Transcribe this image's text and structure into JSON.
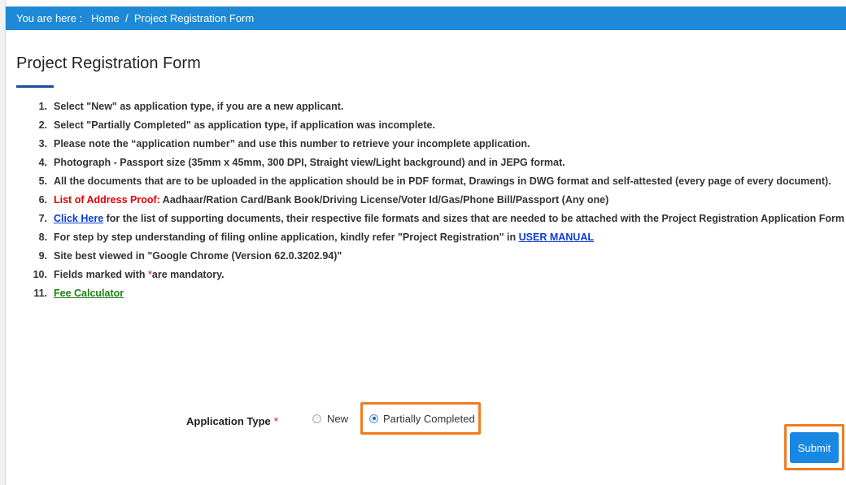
{
  "breadcrumb": {
    "prefix": "You are here :",
    "home": "Home",
    "separator": "/",
    "current": "Project Registration Form"
  },
  "page": {
    "title": "Project Registration Form"
  },
  "instructions": [
    {
      "num": "1.",
      "text": "Select \"New\" as application type, if you are a new applicant."
    },
    {
      "num": "2.",
      "text": "Select \"Partially Completed\" as application type, if application was incomplete."
    },
    {
      "num": "3.",
      "text": "Please note the “application number” and use this number to retrieve your incomplete application."
    },
    {
      "num": "4.",
      "text": "Photograph - Passport size (35mm x 45mm, 300 DPI, Straight view/Light background) and in JEPG format."
    },
    {
      "num": "5.",
      "text": "All the documents that are to be uploaded in the application should be in PDF format, Drawings in DWG format and self-attested (every page of every document)."
    },
    {
      "num": "6.",
      "label": "List of Address Proof:",
      "text": " Aadhaar/Ration Card/Bank Book/Driving License/Voter Id/Gas/Phone Bill/Passport (Any one)"
    },
    {
      "num": "7.",
      "link": "Click Here",
      "text": " for the list of supporting documents, their respective file formats and sizes that are needed to be attached with the Project Registration Application Form"
    },
    {
      "num": "8.",
      "text": "For step by step understanding of filing online application, kindly refer \"Project Registration\" in ",
      "link": "USER MANUAL"
    },
    {
      "num": "9.",
      "text": "Site best viewed in \"Google Chrome (Version 62.0.3202.94)\""
    },
    {
      "num": "10.",
      "text_before": "Fields marked with ",
      "asterisk": "*",
      "text_after": "are mandatory."
    },
    {
      "num": "11.",
      "link": "Fee Calculator"
    }
  ],
  "form": {
    "application_type_label": "Application Type",
    "required_marker": "*",
    "options": [
      {
        "label": "New",
        "selected": false
      },
      {
        "label": "Partially Completed",
        "selected": true
      }
    ],
    "submit_label": "Submit"
  },
  "colors": {
    "breadcrumb_bg": "#1e8ad7",
    "highlight": "#f07c20",
    "submit_bg": "#1a87e3",
    "required_red": "#e00000"
  }
}
